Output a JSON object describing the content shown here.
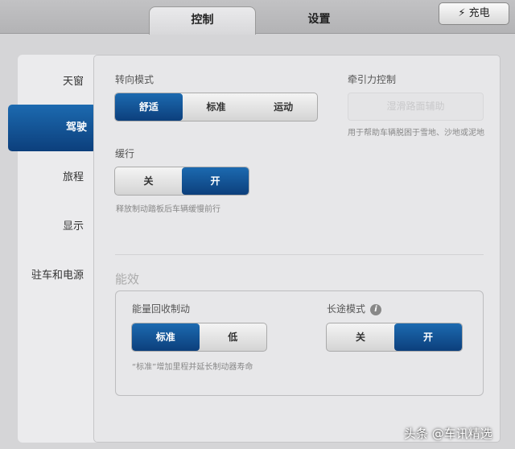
{
  "tabs": [
    {
      "label": "控制"
    },
    {
      "label": "设置"
    }
  ],
  "charge_button": {
    "icon": "lightning-icon",
    "label": "充电"
  },
  "sidebar": {
    "items": [
      {
        "label": "天窗"
      },
      {
        "label": "驾驶"
      },
      {
        "label": "旅程"
      },
      {
        "label": "显示"
      },
      {
        "label": "驻车和电源"
      }
    ]
  },
  "steering": {
    "label": "转向模式",
    "options": [
      "舒适",
      "标准",
      "运动"
    ],
    "selected": "舒适"
  },
  "traction": {
    "label": "牵引力控制",
    "button": "湿滑路面辅助",
    "description": "用于帮助车辆脱困于雪地、沙地或泥地"
  },
  "creep": {
    "label": "缓行",
    "options": [
      "关",
      "开"
    ],
    "selected": "开",
    "description": "释放制动踏板后车辆缓慢前行"
  },
  "efficiency": {
    "title": "能效",
    "regen": {
      "label": "能量回收制动",
      "options": [
        "标准",
        "低"
      ],
      "selected": "标准",
      "description": "“标准”增加里程并延长制动器寿命"
    },
    "range": {
      "label": "长途模式",
      "info_icon": "i",
      "options": [
        "关",
        "开"
      ],
      "selected": "开"
    }
  },
  "colors": {
    "accent": "#15569a"
  },
  "watermark": "头条 @车讯精选"
}
